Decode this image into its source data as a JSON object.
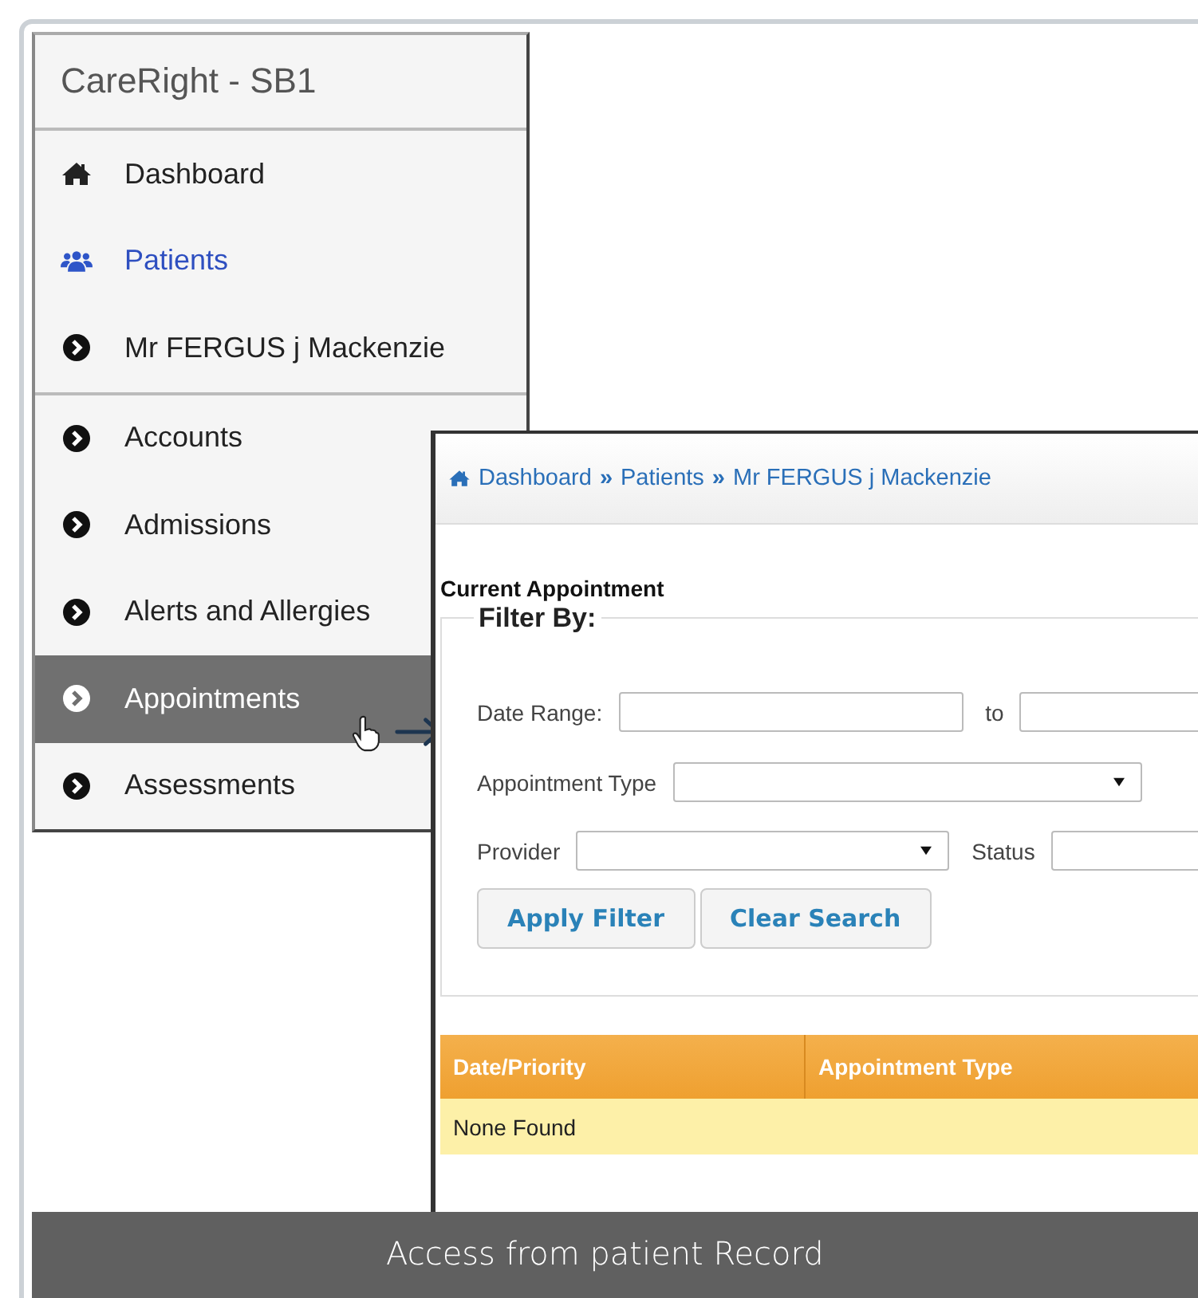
{
  "sidebar": {
    "title": "CareRight - SB1",
    "items": [
      {
        "label": "Dashboard",
        "kind": "home",
        "current": false,
        "selected": false,
        "divider_after": false
      },
      {
        "label": "Patients",
        "kind": "users",
        "current": true,
        "selected": false,
        "divider_after": false
      },
      {
        "label": "Mr FERGUS j Mackenzie",
        "kind": "chevron",
        "current": false,
        "selected": false,
        "divider_after": true
      },
      {
        "label": "Accounts",
        "kind": "chevron",
        "current": false,
        "selected": false,
        "divider_after": false
      },
      {
        "label": "Admissions",
        "kind": "chevron",
        "current": false,
        "selected": false,
        "divider_after": false
      },
      {
        "label": "Alerts and Allergies",
        "kind": "chevron",
        "current": false,
        "selected": false,
        "divider_after": false
      },
      {
        "label": "Appointments",
        "kind": "chevron",
        "current": false,
        "selected": true,
        "divider_after": false
      },
      {
        "label": "Assessments",
        "kind": "chevron",
        "current": false,
        "selected": false,
        "divider_after": false
      }
    ]
  },
  "panel": {
    "breadcrumb": [
      "Dashboard",
      "Patients",
      "Mr FERGUS j Mackenzie"
    ],
    "separator": "»",
    "section_title": "Current Appointment",
    "filter_legend": "Filter By:",
    "filter_rows": [
      {
        "fields": [
          {
            "label": "Date Range:",
            "kind": "text"
          },
          {
            "label": "to",
            "kind": "text"
          }
        ]
      },
      {
        "fields": [
          {
            "label": "Appointment Type",
            "kind": "select"
          }
        ]
      },
      {
        "fields": [
          {
            "label": "Provider",
            "kind": "select"
          },
          {
            "label": "Status",
            "kind": "text"
          }
        ]
      }
    ],
    "buttons": [
      "Apply Filter",
      "Clear Search"
    ],
    "table": {
      "columns": [
        "Date/Priority",
        "Appointment Type"
      ],
      "empty_message": "None Found"
    }
  },
  "caption": "Access from patient Record"
}
